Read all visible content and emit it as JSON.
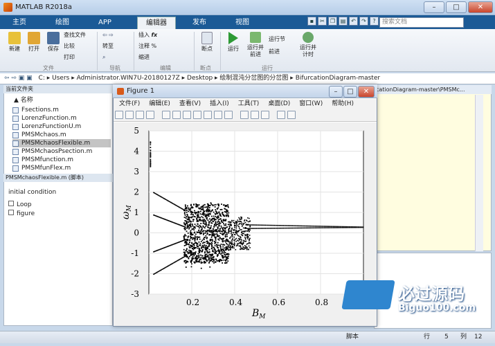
{
  "app": {
    "title": "MATLAB R2018a"
  },
  "tabs": [
    "主页",
    "绘图",
    "APP",
    "编辑器",
    "发布",
    "视图"
  ],
  "search": {
    "placeholder": "搜索文档"
  },
  "ribbon": {
    "file": [
      "新建",
      "打开",
      "保存"
    ],
    "file_small": [
      "查找文件",
      "比较",
      "打印"
    ],
    "nav": [
      "转至"
    ],
    "edit": [
      "插入",
      "注释",
      "缩进"
    ],
    "breakpoint": "断点",
    "run": [
      "运行",
      "运行并\n前进",
      "运行节",
      "前进",
      "运行并\n计时"
    ],
    "groups": [
      "文件",
      "导航",
      "编辑",
      "断点",
      "运行"
    ]
  },
  "address": {
    "segments": [
      "C:",
      "Users",
      "Administrator.WIN7U-20180127Z",
      "Desktop",
      "绘制混沌分岔图的分岔图",
      "BifurcationDiagram-master"
    ]
  },
  "left_panel": {
    "title": "当前文件夹",
    "col": "名称",
    "files": [
      "Fsections.m",
      "LorenzFunction.m",
      "LorenzFunctionU.m",
      "PMSMchaos.m",
      "PMSMchaosFlexible.m",
      "PMSMchaosPsection.m",
      "PMSMfunction.m",
      "PMSMfunFlex.m"
    ],
    "selected": "PMSMchaosFlexible.m (脚本)",
    "outline_title": "initial condition",
    "outline": [
      "Loop",
      "figure"
    ]
  },
  "editor": {
    "path_fragment": "cationDiagram-master\\PMSMc..."
  },
  "figure": {
    "title": "Figure 1",
    "menu": [
      "文件(F)",
      "编辑(E)",
      "查看(V)",
      "插入(I)",
      "工具(T)",
      "桌面(D)",
      "窗口(W)",
      "帮助(H)"
    ]
  },
  "chart_data": {
    "type": "scatter",
    "xlabel": "B_M",
    "ylabel": "ω_M",
    "xlim": [
      0,
      1.0
    ],
    "ylim": [
      -3,
      5
    ],
    "xticks": [
      "0.2",
      "0.4",
      "0.6",
      "0.8"
    ],
    "yticks": [
      "-3",
      "-2",
      "-1",
      "0",
      "1",
      "2",
      "3",
      "4",
      "5"
    ],
    "grid": true
  },
  "status": {
    "script": "脚本",
    "row_label": "行",
    "row": "5",
    "col_label": "列",
    "col": "12"
  },
  "watermark": {
    "text": "必过源码",
    "url": "Biguo100.com"
  }
}
